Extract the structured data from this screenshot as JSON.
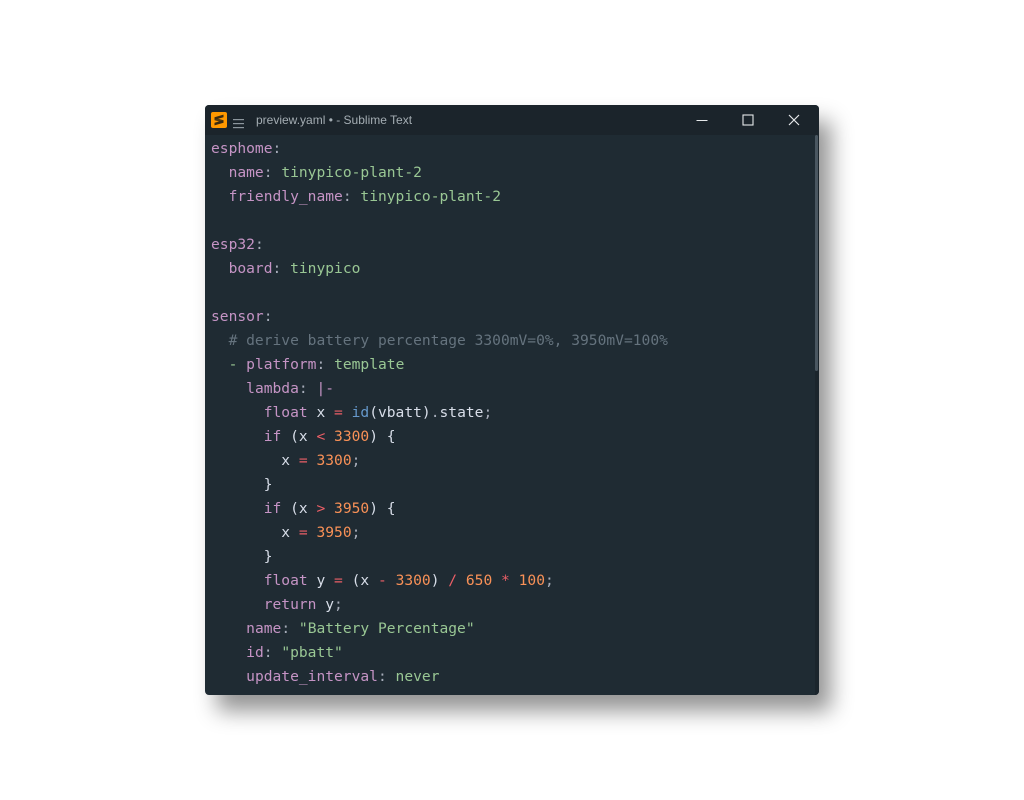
{
  "window": {
    "title": "preview.yaml • - Sublime Text",
    "app_icon": "sublime-text-logo",
    "menu_icon": "hamburger-menu-icon",
    "controls": [
      "minimize-icon",
      "maximize-icon",
      "close-icon"
    ]
  },
  "editor": {
    "language": "yaml",
    "lines": [
      [
        {
          "t": "esphome",
          "c": "k"
        },
        {
          "t": ":",
          "c": "p"
        }
      ],
      [
        {
          "t": "  "
        },
        {
          "t": "name",
          "c": "k"
        },
        {
          "t": ":",
          "c": "p"
        },
        {
          "t": " "
        },
        {
          "t": "tinypico-plant-2",
          "c": "s"
        }
      ],
      [
        {
          "t": "  "
        },
        {
          "t": "friendly_name",
          "c": "k"
        },
        {
          "t": ":",
          "c": "p"
        },
        {
          "t": " "
        },
        {
          "t": "tinypico-plant-2",
          "c": "s"
        }
      ],
      [],
      [
        {
          "t": "esp32",
          "c": "k"
        },
        {
          "t": ":",
          "c": "p"
        }
      ],
      [
        {
          "t": "  "
        },
        {
          "t": "board",
          "c": "k"
        },
        {
          "t": ":",
          "c": "p"
        },
        {
          "t": " "
        },
        {
          "t": "tinypico",
          "c": "s"
        }
      ],
      [],
      [
        {
          "t": "sensor",
          "c": "k"
        },
        {
          "t": ":",
          "c": "p"
        }
      ],
      [
        {
          "t": "  "
        },
        {
          "t": "# derive battery percentage 3300mV=0%, 3950mV=100%",
          "c": "c"
        }
      ],
      [
        {
          "t": "  "
        },
        {
          "t": "-",
          "c": "s"
        },
        {
          "t": " "
        },
        {
          "t": "platform",
          "c": "k"
        },
        {
          "t": ":",
          "c": "p"
        },
        {
          "t": " "
        },
        {
          "t": "template",
          "c": "s"
        }
      ],
      [
        {
          "t": "    "
        },
        {
          "t": "lambda",
          "c": "k"
        },
        {
          "t": ":",
          "c": "p"
        },
        {
          "t": " "
        },
        {
          "t": "|-",
          "c": "k"
        }
      ],
      [
        {
          "t": "      "
        },
        {
          "t": "float",
          "c": "t"
        },
        {
          "t": " x ",
          "c": "v"
        },
        {
          "t": "=",
          "c": "o"
        },
        {
          "t": " "
        },
        {
          "t": "id",
          "c": "f"
        },
        {
          "t": "(vbatt)",
          "c": "v"
        },
        {
          "t": ".",
          "c": "p"
        },
        {
          "t": "state",
          "c": "v"
        },
        {
          "t": ";",
          "c": "p"
        }
      ],
      [
        {
          "t": "      "
        },
        {
          "t": "if",
          "c": "t"
        },
        {
          "t": " (x ",
          "c": "v"
        },
        {
          "t": "<",
          "c": "o"
        },
        {
          "t": " "
        },
        {
          "t": "3300",
          "c": "n"
        },
        {
          "t": ") {",
          "c": "v"
        }
      ],
      [
        {
          "t": "        "
        },
        {
          "t": "x ",
          "c": "v"
        },
        {
          "t": "=",
          "c": "o"
        },
        {
          "t": " "
        },
        {
          "t": "3300",
          "c": "n"
        },
        {
          "t": ";",
          "c": "p"
        }
      ],
      [
        {
          "t": "      "
        },
        {
          "t": "}",
          "c": "v"
        }
      ],
      [
        {
          "t": "      "
        },
        {
          "t": "if",
          "c": "t"
        },
        {
          "t": " (x ",
          "c": "v"
        },
        {
          "t": ">",
          "c": "o"
        },
        {
          "t": " "
        },
        {
          "t": "3950",
          "c": "n"
        },
        {
          "t": ") {",
          "c": "v"
        }
      ],
      [
        {
          "t": "        "
        },
        {
          "t": "x ",
          "c": "v"
        },
        {
          "t": "=",
          "c": "o"
        },
        {
          "t": " "
        },
        {
          "t": "3950",
          "c": "n"
        },
        {
          "t": ";",
          "c": "p"
        }
      ],
      [
        {
          "t": "      "
        },
        {
          "t": "}",
          "c": "v"
        }
      ],
      [
        {
          "t": "      "
        },
        {
          "t": "float",
          "c": "t"
        },
        {
          "t": " y ",
          "c": "v"
        },
        {
          "t": "=",
          "c": "o"
        },
        {
          "t": " (x ",
          "c": "v"
        },
        {
          "t": "-",
          "c": "o"
        },
        {
          "t": " "
        },
        {
          "t": "3300",
          "c": "n"
        },
        {
          "t": ") ",
          "c": "v"
        },
        {
          "t": "/",
          "c": "o"
        },
        {
          "t": " "
        },
        {
          "t": "650",
          "c": "n"
        },
        {
          "t": " "
        },
        {
          "t": "*",
          "c": "o"
        },
        {
          "t": " "
        },
        {
          "t": "100",
          "c": "n"
        },
        {
          "t": ";",
          "c": "p"
        }
      ],
      [
        {
          "t": "      "
        },
        {
          "t": "return",
          "c": "t"
        },
        {
          "t": " y",
          "c": "v"
        },
        {
          "t": ";",
          "c": "p"
        }
      ],
      [
        {
          "t": "    "
        },
        {
          "t": "name",
          "c": "k"
        },
        {
          "t": ":",
          "c": "p"
        },
        {
          "t": " "
        },
        {
          "t": "\"Battery Percentage\"",
          "c": "s"
        }
      ],
      [
        {
          "t": "    "
        },
        {
          "t": "id",
          "c": "k"
        },
        {
          "t": ":",
          "c": "p"
        },
        {
          "t": " "
        },
        {
          "t": "\"pbatt\"",
          "c": "s"
        }
      ],
      [
        {
          "t": "    "
        },
        {
          "t": "update_interval",
          "c": "k"
        },
        {
          "t": ":",
          "c": "p"
        },
        {
          "t": " "
        },
        {
          "t": "never",
          "c": "s"
        }
      ]
    ]
  },
  "colors": {
    "background": "#1f2b33",
    "titlebar": "#1b242b",
    "key": "#c594c5",
    "string": "#99c794",
    "comment": "#65737e",
    "number": "#f99157",
    "operator": "#ec5f67",
    "function": "#6699cc"
  }
}
